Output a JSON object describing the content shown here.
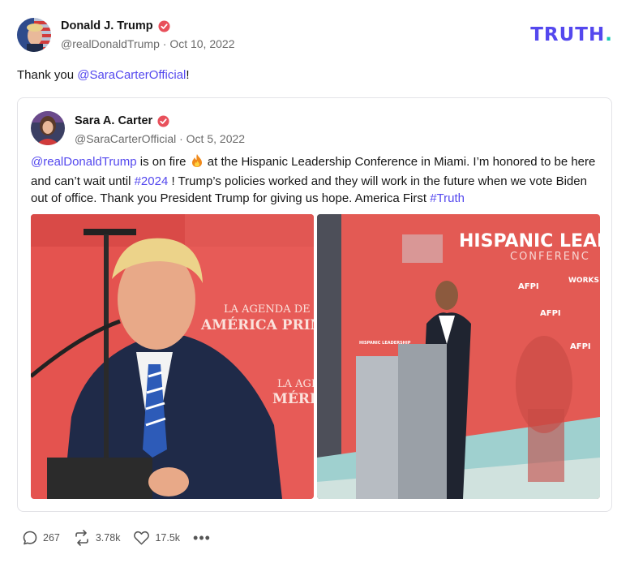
{
  "author": {
    "name": "Donald J. Trump",
    "handle": "@realDonaldTrump",
    "separator": "·",
    "date": "Oct 10, 2022"
  },
  "brand": {
    "logo_text": "TRUTH",
    "logo_dot": "."
  },
  "post": {
    "text_prefix": "Thank you ",
    "mention": "@SaraCarterOfficial",
    "text_suffix": "!"
  },
  "quoted": {
    "name": "Sara A. Carter",
    "handle": "@SaraCarterOfficial",
    "separator": "·",
    "date": "Oct 5, 2022",
    "mention": "@realDonaldTrump",
    "text_1": " is on fire ",
    "text_2": " at the Hispanic Leadership Conference in Miami. I’m honored to be here and can’t wait until ",
    "hashtag_1": "#2024",
    "text_3": " ! Trump’s policies worked and they will work in the future when we vote Biden out of office. Thank you President Trump for giving us hope. America First ",
    "hashtag_2": "#Truth",
    "left_image_text_1": "LA AGENDA DE",
    "left_image_text_2": "AMÉRICA PRIMERO",
    "left_image_text_3": "LA AGEN",
    "left_image_text_4": "MÉRICA",
    "right_image_banner_1": "HISPANIC LEAD",
    "right_image_banner_2": "CONFERENC",
    "right_image_podium": "HISPANIC LEADERSHIP",
    "right_image_logo_1": "AFPI",
    "right_image_logo_2": "WORKS"
  },
  "actions": {
    "replies": "267",
    "retruths": "3.78k",
    "likes": "17.5k",
    "more": "•••"
  },
  "colors": {
    "accent": "#5448ee",
    "verified": "#e8505b",
    "logo_dot": "#17c9b3",
    "stage_red": "#e4534f"
  }
}
